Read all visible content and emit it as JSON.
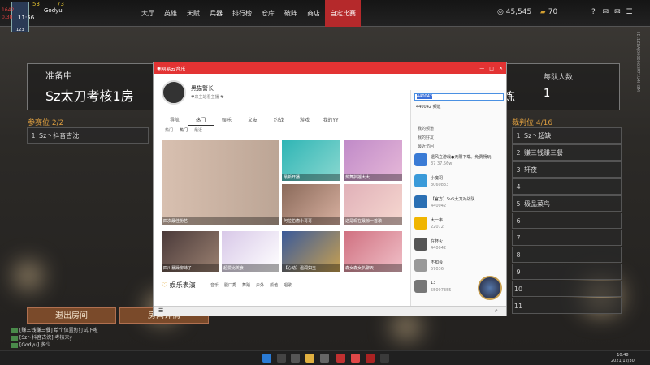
{
  "hud": {
    "ping": "53",
    "fps": "73",
    "name": "Godyu",
    "level": "123",
    "l1": "1642",
    "l2": "0.38",
    "time": "11:56"
  },
  "topnav": [
    "大厅",
    "英雄",
    "天赋",
    "兵器",
    "排行榜",
    "仓库",
    "破阵",
    "商店",
    "自定比赛"
  ],
  "topnav_active": 8,
  "currency": {
    "money": "45,545",
    "coupon": "70"
  },
  "room": {
    "state": "准备中",
    "title": "Sz太刀考核1房",
    "mode_tail": "炼",
    "per_team_label": "每队人数",
    "per_team_value": "1"
  },
  "participants": {
    "label": "参赛位 2/2",
    "rows": [
      {
        "n": "1",
        "name": "Sz丶抖音古沈"
      }
    ]
  },
  "referees": {
    "label": "裁判位 4/16",
    "rows": [
      {
        "n": "1",
        "name": "Sz丶超缺"
      },
      {
        "n": "2",
        "name": "赚三钱赚三餐"
      },
      {
        "n": "3",
        "name": "轩夜"
      },
      {
        "n": "4",
        "name": ""
      },
      {
        "n": "5",
        "name": "极品菜鸟"
      },
      {
        "n": "6",
        "name": ""
      },
      {
        "n": "7",
        "name": ""
      },
      {
        "n": "8",
        "name": ""
      },
      {
        "n": "9",
        "name": ""
      },
      {
        "n": "10",
        "name": ""
      },
      {
        "n": "11",
        "name": ""
      }
    ]
  },
  "buttons": {
    "exit": "退出房间",
    "detail": "房间详情"
  },
  "chat": [
    "[赚三钱赚三餐] 给个位置打打试下啦",
    "[Sz丶抖音古沈] 考核来y",
    "[Godyu] 多少"
  ],
  "watermark": "ID:1ZBAJ0000063R71U4HGM",
  "music": {
    "app_title": "网易云音乐",
    "profile_name": "黑猫警长",
    "profile_sub": "♥来主站看主播 ♥",
    "tabs": [
      "导航",
      "热门",
      "娱乐",
      "文友",
      "约战",
      "游戏",
      "我的YY"
    ],
    "active_tab": 1,
    "subtabs": [
      "热门",
      "热门",
      "最近"
    ],
    "cards": [
      {
        "cap": "四次最佳扮艺"
      },
      {
        "cap": "最新开播"
      },
      {
        "cap": "热舞扒摇大大"
      },
      {
        "cap": "阿拉伯唐小哥哥"
      },
      {
        "cap": "这是现在最惊一首歌"
      },
      {
        "cap": "四川暴躁柳妹子"
      },
      {
        "cap": "超爱比美食"
      },
      {
        "cap": "【心动】温润如玉"
      },
      {
        "cap": "森女森女扒聊天"
      }
    ],
    "ent_title": "娱乐表演",
    "ent_tabs": [
      "音乐",
      "脱口秀",
      "舞蹈",
      "户外",
      "颜值",
      "唱歌"
    ],
    "search_value": "440042",
    "search_result": "440042 频道",
    "side_labels": [
      "我的频道",
      "我的好友",
      "最近访问"
    ],
    "side_rows": [
      {
        "t": "遗风立游戏●无限下载。免费畅玩",
        "s": "37 37.56w",
        "color": "#3a7bd5"
      },
      {
        "t": "小魔羽",
        "s": "3060833",
        "color": "#3a9ad9"
      },
      {
        "t": "【官方】5v5太刀对战队...",
        "s": "440042",
        "color": "#2a6fb3"
      },
      {
        "t": "大一串",
        "s": "22072",
        "color": "#f0b500"
      },
      {
        "t": "在杯火",
        "s": "440042",
        "color": "#555"
      },
      {
        "t": "不知会",
        "s": "57036",
        "color": "#999"
      },
      {
        "t": "13",
        "s": "55097355",
        "color": "#777"
      }
    ]
  },
  "clock": {
    "time": "10:48",
    "date": "2021/12/30"
  }
}
